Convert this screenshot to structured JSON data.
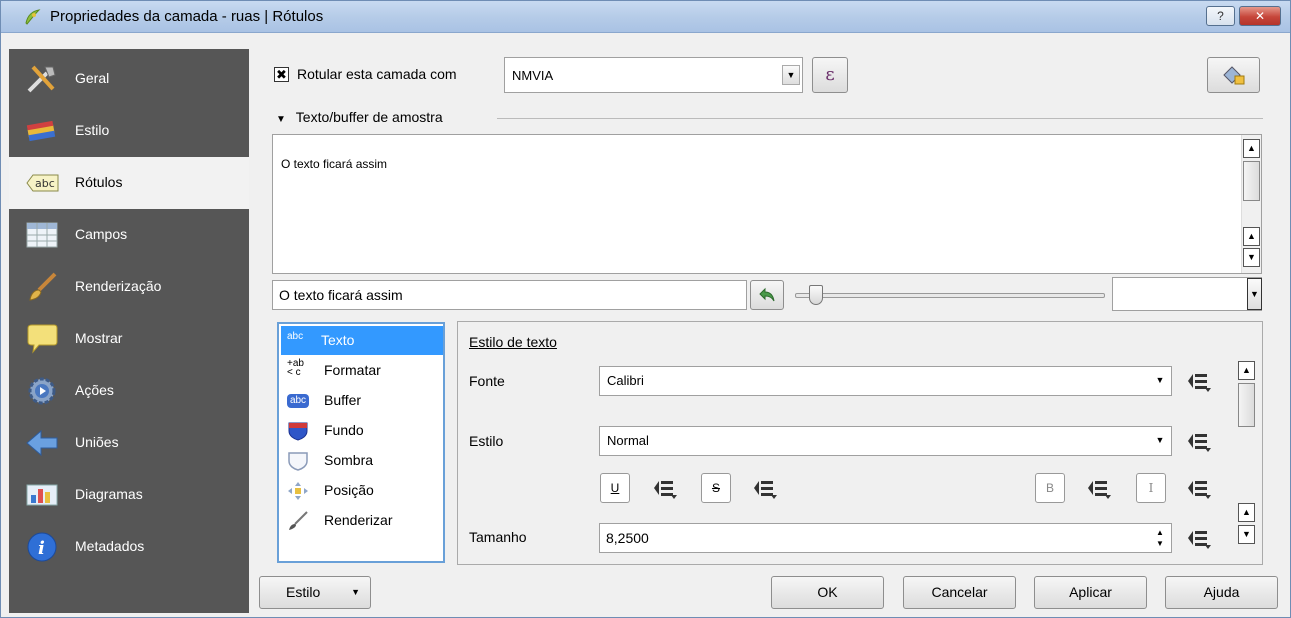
{
  "window": {
    "title": "Propriedades da camada - ruas | Rótulos",
    "help_label": "?",
    "close_label": "✕"
  },
  "sidebar": {
    "items": [
      {
        "label": "Geral",
        "icon": "tools-icon"
      },
      {
        "label": "Estilo",
        "icon": "brush-icon"
      },
      {
        "label": "Rótulos",
        "icon": "abc-label-icon"
      },
      {
        "label": "Campos",
        "icon": "table-icon"
      },
      {
        "label": "Renderização",
        "icon": "paintbrush-icon"
      },
      {
        "label": "Mostrar",
        "icon": "speech-bubble-icon"
      },
      {
        "label": "Ações",
        "icon": "gear-icon"
      },
      {
        "label": "Uniões",
        "icon": "join-arrow-icon"
      },
      {
        "label": "Diagramas",
        "icon": "chart-icon"
      },
      {
        "label": "Metadados",
        "icon": "info-icon"
      }
    ],
    "active_index": 2
  },
  "label_with": {
    "checkbox_label": "Rotular esta camada com",
    "checked": true,
    "checkmark": "✖",
    "field_value": "NMVIA",
    "expression_label": "ε"
  },
  "sample": {
    "section_title": "Texto/buffer de amostra",
    "preview_text": "O texto ficará assim",
    "input_value": "O texto ficará assim"
  },
  "tabs": [
    {
      "label": "Texto",
      "icon": "abc-text-icon",
      "badge": "abc"
    },
    {
      "label": "Formatar",
      "icon": "format-icon",
      "badge": "+ab\n< c"
    },
    {
      "label": "Buffer",
      "icon": "abc-buffer-icon",
      "badge": "abc"
    },
    {
      "label": "Fundo",
      "icon": "shield-icon",
      "badge": ""
    },
    {
      "label": "Sombra",
      "icon": "shadow-icon",
      "badge": ""
    },
    {
      "label": "Posição",
      "icon": "position-icon",
      "badge": ""
    },
    {
      "label": "Renderizar",
      "icon": "brush-icon",
      "badge": ""
    }
  ],
  "text_style": {
    "title": "Estilo de texto",
    "font_label": "Fonte",
    "font_value": "Calibri",
    "style_label": "Estilo",
    "style_value": "Normal",
    "underline_label": "U",
    "strike_label": "S",
    "bold_label": "B",
    "italic_label": "I",
    "size_label": "Tamanho",
    "size_value": "8,2500"
  },
  "footer": {
    "style_button": "Estilo",
    "ok": "OK",
    "cancel": "Cancelar",
    "apply": "Aplicar",
    "help": "Ajuda"
  },
  "colors": {
    "sidebar_bg": "#565656",
    "selection": "#3399ff",
    "close": "#c6463a"
  }
}
